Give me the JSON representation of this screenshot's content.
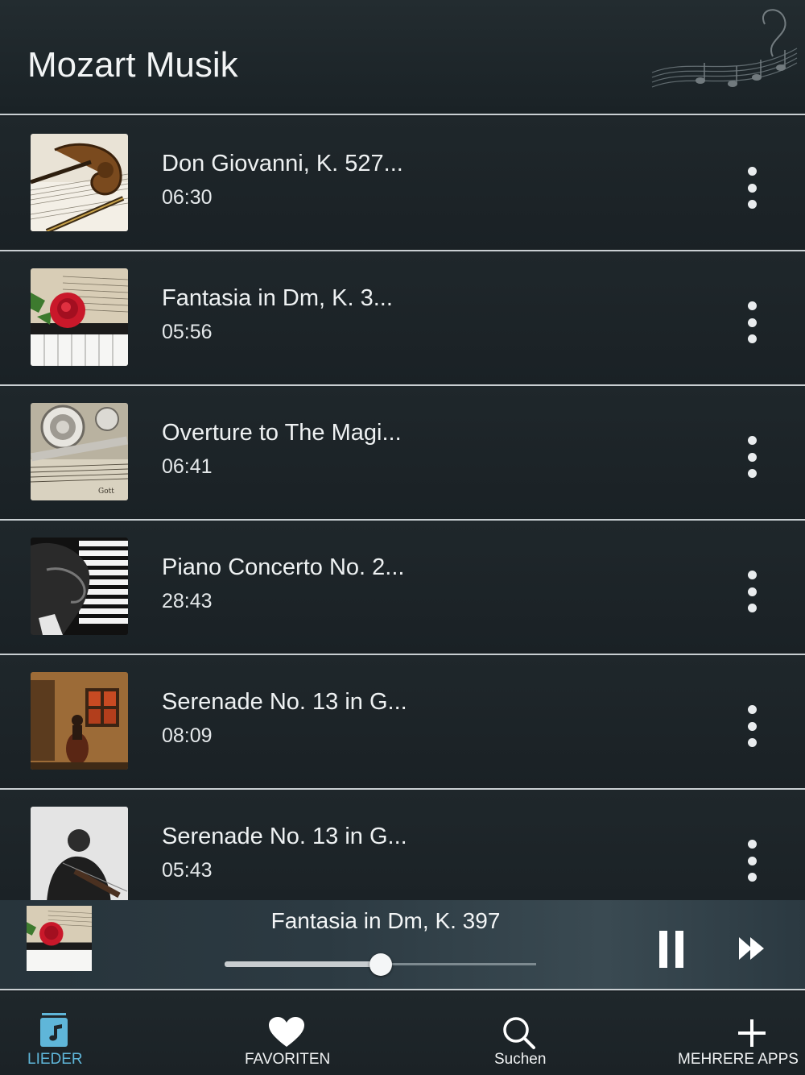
{
  "header": {
    "title": "Mozart Musik"
  },
  "songs": [
    {
      "title": "Don Giovanni, K. 527...",
      "duration": "06:30",
      "thumb": "violin-scroll"
    },
    {
      "title": "Fantasia in Dm, K. 3...",
      "duration": "05:56",
      "thumb": "rose-piano"
    },
    {
      "title": "Overture to The Magi...",
      "duration": "06:41",
      "thumb": "flute-sheet"
    },
    {
      "title": "Piano Concerto No. 2...",
      "duration": "28:43",
      "thumb": "piano-hands"
    },
    {
      "title": "Serenade No. 13 in G...",
      "duration": "08:09",
      "thumb": "cellist-wall"
    },
    {
      "title": "Serenade No. 13 in G...",
      "duration": "05:43",
      "thumb": "violinist"
    }
  ],
  "player": {
    "now_playing": "Fantasia in Dm, K. 397",
    "progress": 0.5,
    "thumb": "rose-piano"
  },
  "tabs": [
    {
      "label": "LIEDER",
      "icon": "music-note-icon",
      "active": true
    },
    {
      "label": "FAVORITEN",
      "icon": "heart-icon",
      "active": false
    },
    {
      "label": "Suchen",
      "icon": "search-icon",
      "active": false
    },
    {
      "label": "MEHRERE APPS",
      "icon": "plus-icon",
      "active": false
    }
  ],
  "colors": {
    "accent": "#5fb6d9",
    "divider": "#c9cfd2",
    "background": "#1c2226"
  }
}
